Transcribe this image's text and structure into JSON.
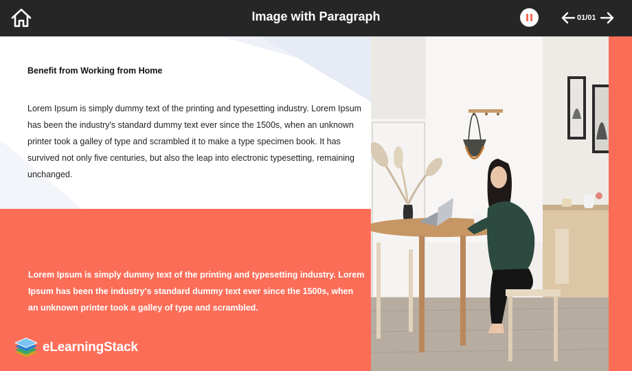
{
  "header": {
    "title": "Image with Paragraph",
    "counter": "01/01",
    "home_icon": "home-icon",
    "pause_icon": "pause-icon",
    "prev_icon": "arrow-left-icon",
    "next_icon": "arrow-right-icon"
  },
  "content": {
    "heading": "Benefit from Working from Home",
    "paragraph1": "Lorem Ipsum is simply dummy text of the printing and typesetting industry. Lorem Ipsum has been the industry's standard dummy text ever since the 1500s, when an unknown printer took a galley of type and scrambled it to make a type specimen book. It has survived not only five centuries, but also the leap into electronic typesetting, remaining unchanged.",
    "paragraph2": "Lorem Ipsum is simply dummy text of the printing and typesetting industry. Lorem Ipsum has been the industry's standard dummy text ever since the 1500s, when an unknown printer took a galley of type and scrambled."
  },
  "brand": {
    "name": "eLearningStack"
  },
  "colors": {
    "topbar": "#262626",
    "accent": "#fc6d58",
    "pause_icon": "#f26b56",
    "text_dark": "#222222",
    "text_light": "#ffffff"
  }
}
